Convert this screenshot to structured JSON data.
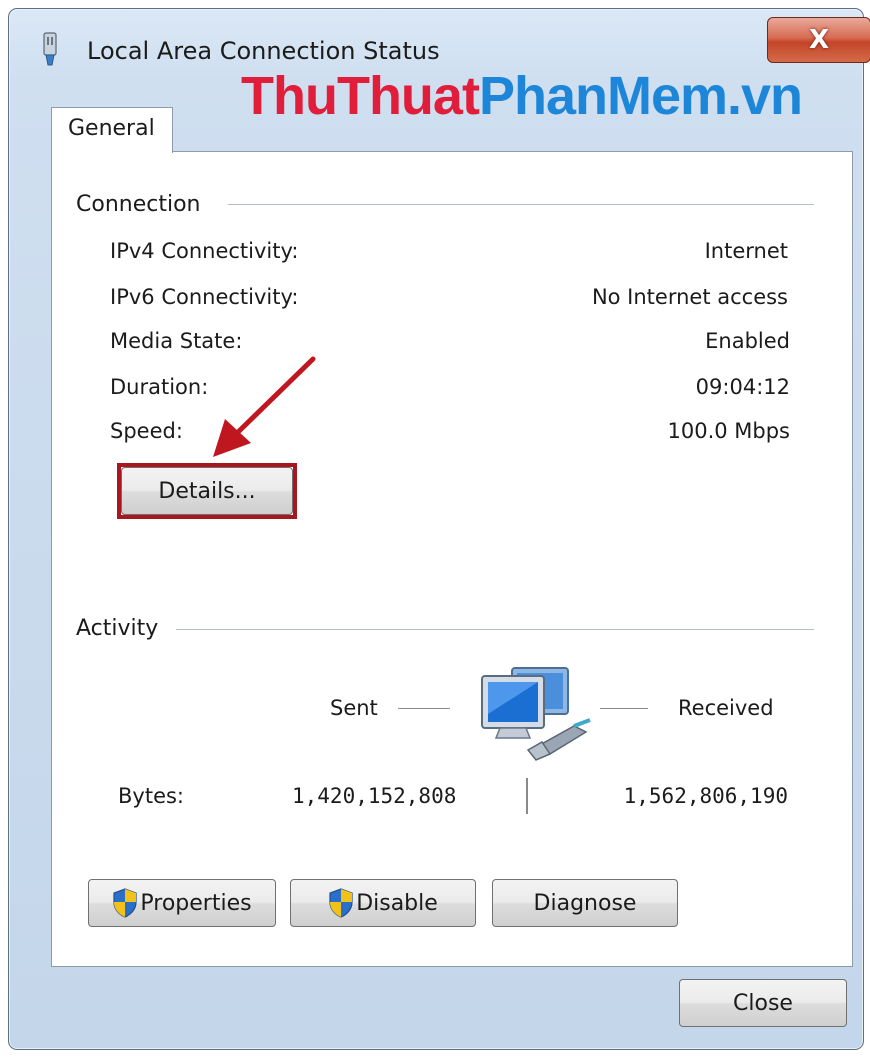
{
  "window": {
    "title": "Local Area Connection Status",
    "close_label": "X"
  },
  "watermark": {
    "part1": "ThuThuat",
    "part2": "PhanMem.vn"
  },
  "tabs": [
    {
      "label": "General",
      "selected": true
    }
  ],
  "connection": {
    "heading": "Connection",
    "rows": [
      {
        "label": "IPv4 Connectivity:",
        "value": "Internet"
      },
      {
        "label": "IPv6 Connectivity:",
        "value": "No Internet access"
      },
      {
        "label": "Media State:",
        "value": "Enabled"
      },
      {
        "label": "Duration:",
        "value": "09:04:12"
      },
      {
        "label": "Speed:",
        "value": "100.0 Mbps"
      }
    ],
    "details_button": "Details..."
  },
  "activity": {
    "heading": "Activity",
    "sent_label": "Sent",
    "received_label": "Received",
    "bytes_label": "Bytes:",
    "bytes_sent": "1,420,152,808",
    "bytes_received": "1,562,806,190"
  },
  "buttons": {
    "properties": "Properties",
    "disable": "Disable",
    "diagnose": "Diagnose",
    "close": "Close"
  },
  "icons": {
    "titlebar": "network-adapter-icon",
    "activity": "network-computers-icon",
    "shield": "uac-shield-icon",
    "annotation": "red-arrow-annotation"
  },
  "colors": {
    "highlight_border": "#a8161f",
    "arrow": "#c0161f",
    "watermark_red": "#e01d3a",
    "watermark_blue": "#1e86d8"
  }
}
